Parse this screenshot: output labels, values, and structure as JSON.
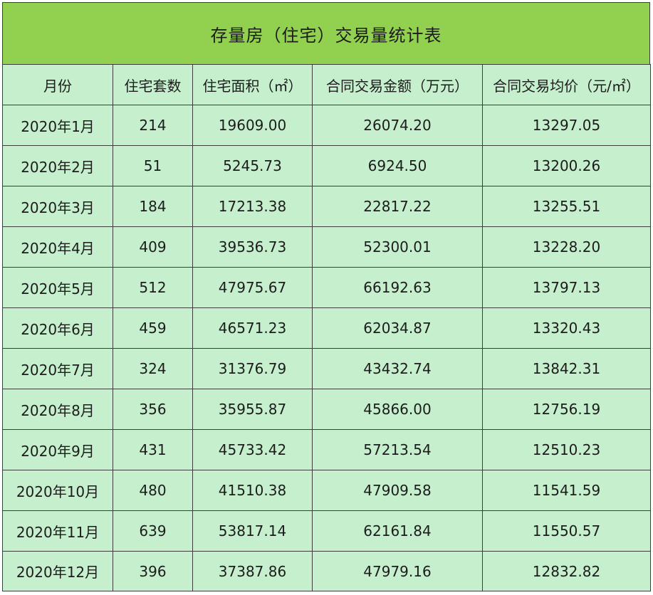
{
  "title": "存量房（住宅）交易量统计表",
  "colors": {
    "title_bg": "#92d050",
    "cell_bg": "#c6efce",
    "border": "#3d3d3d",
    "text": "#1c1c1c"
  },
  "chart_data": {
    "type": "table",
    "title": "存量房（住宅）交易量统计表",
    "columns": [
      "月份",
      "住宅套数",
      "住宅面积（㎡）",
      "合同交易金额（万元）",
      "合同交易均价（元/㎡）"
    ],
    "rows": [
      [
        "2020年1月",
        "214",
        "19609.00",
        "26074.20",
        "13297.05"
      ],
      [
        "2020年2月",
        "51",
        "5245.73",
        "6924.50",
        "13200.26"
      ],
      [
        "2020年3月",
        "184",
        "17213.38",
        "22817.22",
        "13255.51"
      ],
      [
        "2020年4月",
        "409",
        "39536.73",
        "52300.01",
        "13228.20"
      ],
      [
        "2020年5月",
        "512",
        "47975.67",
        "66192.63",
        "13797.13"
      ],
      [
        "2020年6月",
        "459",
        "46571.23",
        "62034.87",
        "13320.43"
      ],
      [
        "2020年7月",
        "324",
        "31376.79",
        "43432.74",
        "13842.31"
      ],
      [
        "2020年8月",
        "356",
        "35955.87",
        "45866.00",
        "12756.19"
      ],
      [
        "2020年9月",
        "431",
        "45733.42",
        "57213.54",
        "12510.23"
      ],
      [
        "2020年10月",
        "480",
        "41510.38",
        "47909.58",
        "11541.59"
      ],
      [
        "2020年11月",
        "639",
        "53817.14",
        "62161.84",
        "11550.57"
      ],
      [
        "2020年12月",
        "396",
        "37387.86",
        "47979.16",
        "12832.82"
      ]
    ]
  }
}
